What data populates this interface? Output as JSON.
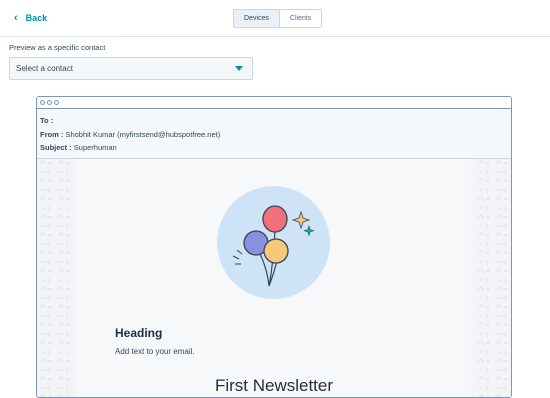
{
  "topbar": {
    "back_label": "Back",
    "tabs": [
      {
        "label": "Devices",
        "active": true
      },
      {
        "label": "Clients",
        "active": false
      }
    ]
  },
  "preview": {
    "label": "Preview as a specific contact",
    "select_value": "Select a contact"
  },
  "email": {
    "to_label": "To :",
    "to_value": "",
    "from_label": "From :",
    "from_value": "Shobhit Kumar (myfirstsend@hubspotfree.net)",
    "subject_label": "Subject :",
    "subject_value": "Superhuman",
    "heading": "Heading",
    "body_text": "Add text to your email.",
    "newsletter_title": "First Newsletter"
  },
  "colors": {
    "accent": "#0091ae",
    "hero_circle": "#cfe3f7",
    "border": "#7c98b6"
  }
}
